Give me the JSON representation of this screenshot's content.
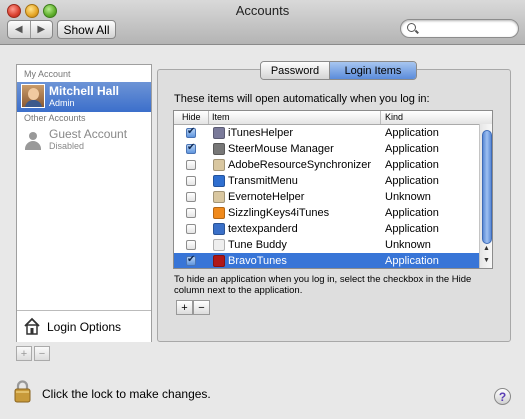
{
  "window": {
    "title": "Accounts"
  },
  "toolbar": {
    "back_icon": "back-arrow-icon",
    "forward_icon": "forward-arrow-icon",
    "show_all_label": "Show All",
    "search_placeholder": ""
  },
  "sidebar": {
    "my_account_header": "My Account",
    "current_user": {
      "name": "Mitchell Hall",
      "role": "Admin"
    },
    "other_accounts_header": "Other Accounts",
    "guest": {
      "name": "Guest Account",
      "status": "Disabled"
    },
    "login_options_label": "Login Options",
    "add_label": "+",
    "remove_label": "−"
  },
  "tabs": [
    {
      "label": "Password",
      "selected": false
    },
    {
      "label": "Login Items",
      "selected": true
    }
  ],
  "login_items": {
    "description": "These items will open automatically when you log in:",
    "columns": {
      "hide": "Hide",
      "item": "Item",
      "kind": "Kind"
    },
    "rows": [
      {
        "hide": true,
        "name": "iTunesHelper",
        "kind": "Application",
        "icon": "itunes-helper-icon",
        "color": "#7a7a9a"
      },
      {
        "hide": true,
        "name": "SteerMouse Manager",
        "kind": "Application",
        "icon": "steermouse-icon",
        "color": "#777777"
      },
      {
        "hide": false,
        "name": "AdobeResourceSynchronizer",
        "kind": "Application",
        "icon": "adobe-resource-icon",
        "color": "#d9c7a0"
      },
      {
        "hide": false,
        "name": "TransmitMenu",
        "kind": "Application",
        "icon": "transmit-menu-icon",
        "color": "#2f6fd0"
      },
      {
        "hide": false,
        "name": "EvernoteHelper",
        "kind": "Unknown",
        "icon": "evernote-helper-icon",
        "color": "#d9c7a0"
      },
      {
        "hide": false,
        "name": "SizzlingKeys4iTunes",
        "kind": "Application",
        "icon": "sizzlingkeys-icon",
        "color": "#f08a1c"
      },
      {
        "hide": false,
        "name": "textexpanderd",
        "kind": "Application",
        "icon": "textexpander-icon",
        "color": "#3a70c8"
      },
      {
        "hide": false,
        "name": "Tune Buddy",
        "kind": "Unknown",
        "icon": "tune-buddy-icon",
        "color": "#eeeeee"
      },
      {
        "hide": true,
        "name": "BravoTunes",
        "kind": "Application",
        "icon": "bravotunes-icon",
        "color": "#b01818",
        "selected": true
      }
    ],
    "hint": "To hide an application when you log in, select the checkbox in the Hide column next to the application.",
    "add_label": "+",
    "remove_label": "−"
  },
  "footer": {
    "lock_text": "Click the lock to make changes.",
    "help_label": "?"
  }
}
